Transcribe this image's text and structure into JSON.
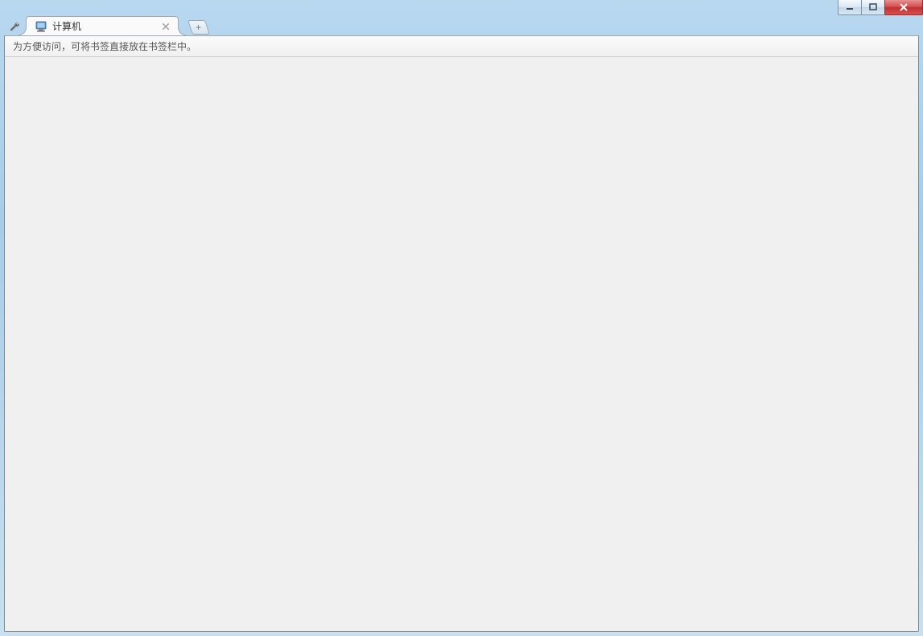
{
  "tab": {
    "title": "计算机",
    "favicon_name": "computer-icon"
  },
  "bookmarks_bar": {
    "hint": "为方便访问，可将书签直接放在书签栏中。"
  },
  "window_controls": {
    "minimize": "minimize",
    "maximize": "maximize",
    "close": "close"
  }
}
